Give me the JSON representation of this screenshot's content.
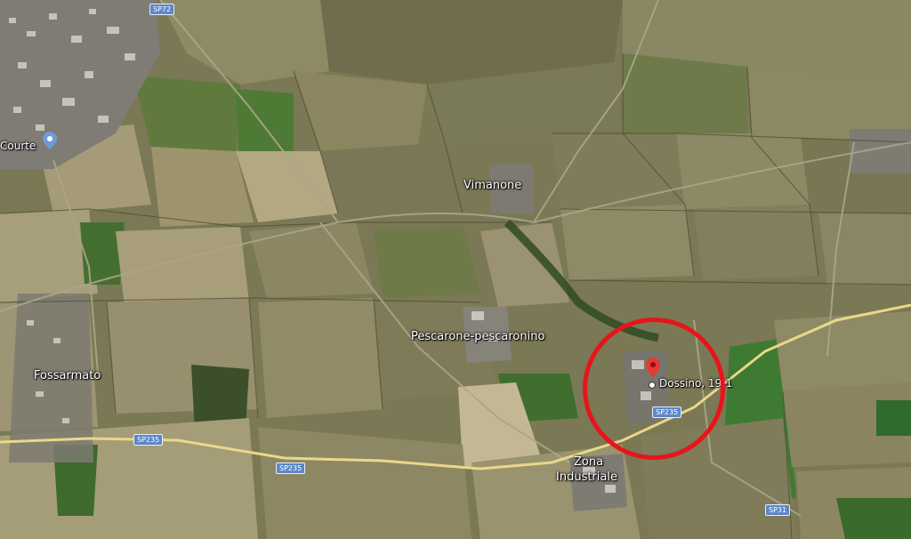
{
  "places": {
    "town_nw": "Courte",
    "vimanone": "Vimanone",
    "pescarone": "Pescarone-pescaronino",
    "fossarmato": "Fossarmato",
    "zona_industriale_1": "Zona",
    "zona_industriale_2": "Industriale",
    "marker": "Dossino, 19-1"
  },
  "roads": {
    "sp72": "SP72",
    "sp235_a": "SP235",
    "sp235_b": "SP235",
    "sp235_c": "SP235",
    "sp31": "SP31"
  },
  "colors": {
    "highlight_circle": "#e8141b",
    "marker_pin": "#e53935",
    "road_main": "#e9d88a",
    "shield": "#5d87c9"
  },
  "icons": {
    "marker": "map-pin-icon",
    "town_pin": "location-pin-icon"
  }
}
